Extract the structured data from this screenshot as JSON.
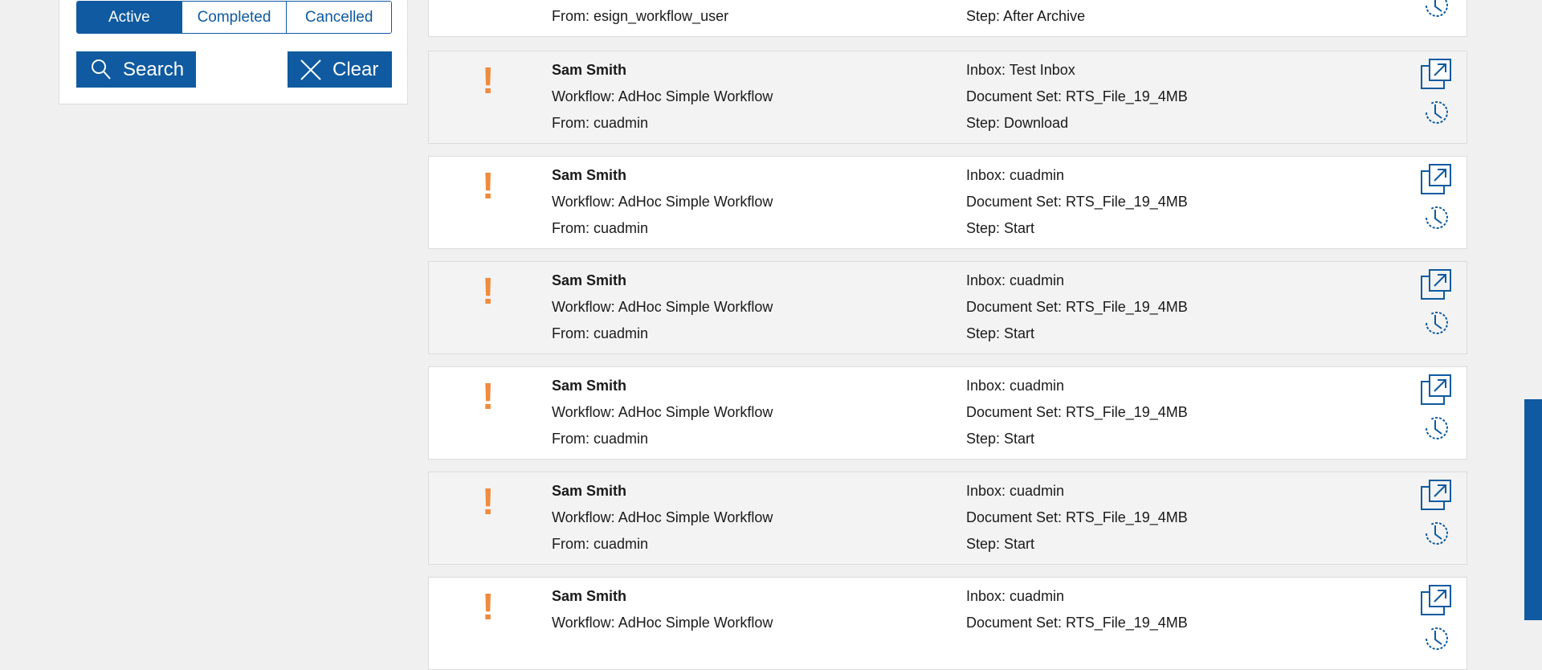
{
  "filters": {
    "tabs": [
      "Active",
      "Completed",
      "Cancelled"
    ],
    "active_tab": "Active",
    "search_label": "Search",
    "clear_label": "Clear"
  },
  "colors": {
    "accent": "#0f5aa0",
    "priority": "#f08a3c"
  },
  "tasks": [
    {
      "name": "",
      "workflow": "",
      "from": "From: esign_workflow_user",
      "inbox": "",
      "document_set": "",
      "step": "Step: After Archive"
    },
    {
      "name": "Sam Smith",
      "workflow": "Workflow: AdHoc Simple Workflow",
      "from": "From: cuadmin",
      "inbox": "Inbox: Test Inbox",
      "document_set": "Document Set: RTS_File_19_4MB",
      "step": "Step: Download"
    },
    {
      "name": "Sam Smith",
      "workflow": "Workflow: AdHoc Simple Workflow",
      "from": "From: cuadmin",
      "inbox": "Inbox: cuadmin",
      "document_set": "Document Set: RTS_File_19_4MB",
      "step": "Step: Start"
    },
    {
      "name": "Sam Smith",
      "workflow": "Workflow: AdHoc Simple Workflow",
      "from": "From: cuadmin",
      "inbox": "Inbox: cuadmin",
      "document_set": "Document Set: RTS_File_19_4MB",
      "step": "Step: Start"
    },
    {
      "name": "Sam Smith",
      "workflow": "Workflow: AdHoc Simple Workflow",
      "from": "From: cuadmin",
      "inbox": "Inbox: cuadmin",
      "document_set": "Document Set: RTS_File_19_4MB",
      "step": "Step: Start"
    },
    {
      "name": "Sam Smith",
      "workflow": "Workflow: AdHoc Simple Workflow",
      "from": "From: cuadmin",
      "inbox": "Inbox: cuadmin",
      "document_set": "Document Set: RTS_File_19_4MB",
      "step": "Step: Start"
    },
    {
      "name": "Sam Smith",
      "workflow": "Workflow: AdHoc Simple Workflow",
      "from": "",
      "inbox": "Inbox: cuadmin",
      "document_set": "Document Set: RTS_File_19_4MB",
      "step": ""
    }
  ],
  "icons": {
    "priority": "exclamation-icon",
    "open": "open-external-icon",
    "history": "history-clock-icon",
    "search": "search-icon",
    "clear": "close-icon"
  }
}
